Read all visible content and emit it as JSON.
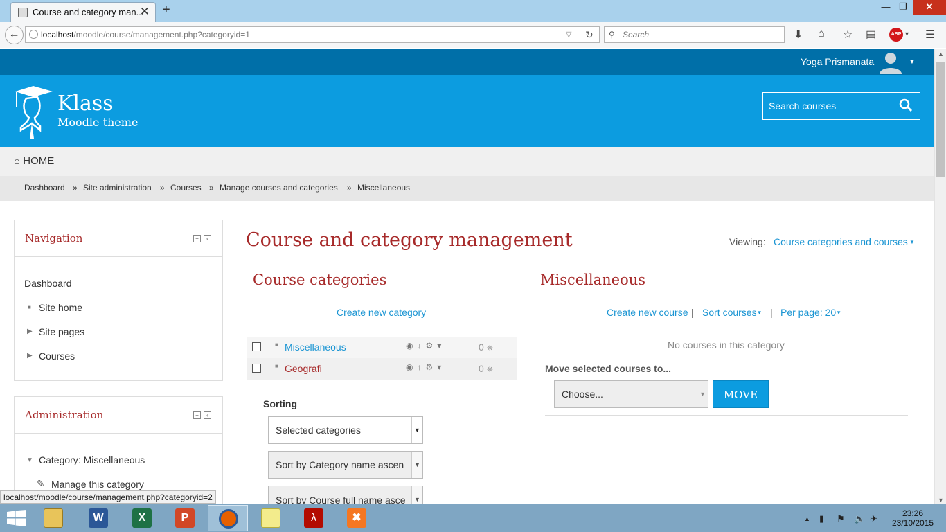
{
  "browser": {
    "tab_title": "Course and category man...",
    "tab_close": "✕",
    "new_tab": "+",
    "url_host": "localhost",
    "url_path": "/moodle/course/management.php?categoryid=1",
    "search_placeholder": "Search",
    "status_url": "localhost/moodle/course/management.php?categoryid=2",
    "window_minimize": "—",
    "window_maximize": "❐",
    "window_close": "✕"
  },
  "topbar": {
    "user_name": "Yoga Prismanata"
  },
  "header": {
    "site_name": "Klass",
    "site_subtitle": "Moodle theme",
    "search_placeholder": "Search courses"
  },
  "nav": {
    "home": "HOME"
  },
  "breadcrumb": [
    "Dashboard",
    "Site administration",
    "Courses",
    "Manage courses and categories",
    "Miscellaneous"
  ],
  "navigation_block": {
    "title": "Navigation",
    "items": [
      "Dashboard",
      "Site home",
      "Site pages",
      "Courses"
    ]
  },
  "admin_block": {
    "title": "Administration",
    "items": [
      "Category: Miscellaneous",
      "Manage this category"
    ]
  },
  "main": {
    "page_title": "Course and category management",
    "viewing_label": "Viewing:",
    "viewing_value": "Course categories and courses",
    "categories_heading": "Course categories",
    "create_category": "Create new category",
    "categories": [
      {
        "name": "Miscellaneous",
        "count": "0"
      },
      {
        "name": "Geografi",
        "count": "0"
      }
    ],
    "sorting_label": "Sorting",
    "sort_selects": [
      "Selected categories",
      "Sort by Category name ascen",
      "Sort by Course full name asce"
    ],
    "course_heading": "Miscellaneous",
    "create_course": "Create new course",
    "sort_courses": "Sort courses",
    "per_page": "Per page: 20",
    "no_courses": "No courses in this category",
    "move_label": "Move selected courses to...",
    "move_select": "Choose...",
    "move_button": "MOVE"
  },
  "taskbar": {
    "time": "23:26",
    "date": "23/10/2015"
  },
  "colors": {
    "header_blue": "#0c9ce0",
    "topbar_blue": "#006fa8",
    "heading_red": "#a72a2a",
    "link_blue": "#1b95d3"
  }
}
